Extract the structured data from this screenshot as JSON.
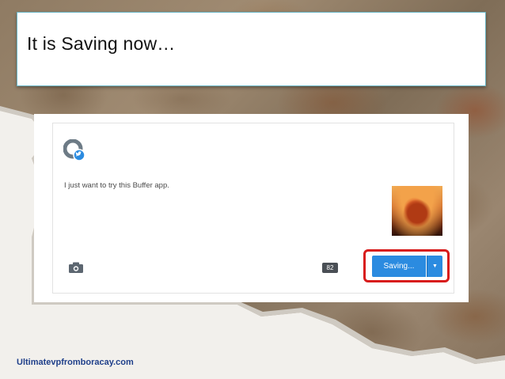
{
  "slide": {
    "title": "It is Saving now…",
    "footer": "Ultimatevpfromboracay.com"
  },
  "composer": {
    "post_text": "I just want to try this Buffer app.",
    "char_count": "82",
    "save_button_label": "Saving...",
    "accent_color": "#2b8be0",
    "highlight_color": "#d81b1b",
    "icons": [
      "twitter-avatar-icon",
      "camera-icon",
      "caret-down-icon"
    ]
  }
}
